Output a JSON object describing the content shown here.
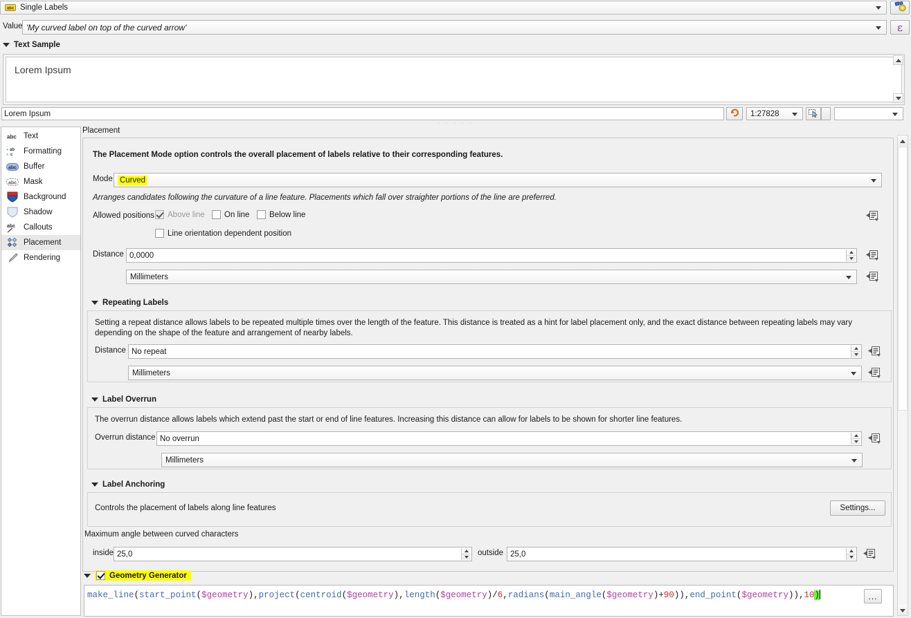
{
  "topbar": {
    "labeling_mode": "Single Labels",
    "labeling_mode_icon": "abc-label-icon",
    "style_button_icon": "style-manager-icon"
  },
  "value_row": {
    "label": "Value",
    "value": "'My curved label on top of the curved arrow'",
    "expression_button_icon": "epsilon-icon"
  },
  "text_sample": {
    "header": "Text Sample",
    "preview_text": "Lorem Ipsum",
    "input_value": "Lorem Ipsum",
    "undo_icon": "undo-arrow-icon",
    "scale": "1:27828",
    "select_icon": "select-cursor-icon",
    "misc_value": ""
  },
  "sidebar": {
    "items": [
      {
        "label": "Text",
        "icon": "text-abc-icon"
      },
      {
        "label": "Formatting",
        "icon": "formatting-icon"
      },
      {
        "label": "Buffer",
        "icon": "buffer-abc-icon"
      },
      {
        "label": "Mask",
        "icon": "mask-abc-icon"
      },
      {
        "label": "Background",
        "icon": "background-shield-icon"
      },
      {
        "label": "Shadow",
        "icon": "shadow-shield-icon"
      },
      {
        "label": "Callouts",
        "icon": "callouts-icon"
      },
      {
        "label": "Placement",
        "icon": "placement-diamonds-icon"
      },
      {
        "label": "Rendering",
        "icon": "rendering-brush-icon"
      }
    ],
    "selected": "Placement"
  },
  "panel": {
    "title": "Placement",
    "intro": "The Placement Mode option controls the overall placement of labels relative to their corresponding features.",
    "mode": {
      "label": "Mode",
      "value": "Curved",
      "highlighted": true
    },
    "mode_description": "Arranges candidates following the curvature of a line feature. Placements which fall over straighter portions of the line are preferred.",
    "allowed_positions": {
      "label": "Allowed positions",
      "options": [
        {
          "label": "Above line",
          "checked": true,
          "disabled": true
        },
        {
          "label": "On line",
          "checked": false,
          "disabled": false
        },
        {
          "label": "Below line",
          "checked": false,
          "disabled": false
        }
      ],
      "line_orientation": {
        "label": "Line orientation dependent position",
        "checked": false
      }
    },
    "distance": {
      "label": "Distance",
      "value": "0,0000",
      "unit": "Millimeters"
    },
    "repeating_labels": {
      "header": "Repeating Labels",
      "description": "Setting a repeat distance allows labels to be repeated multiple times over the length of the feature. This distance is treated as a hint for label placement only, and the exact distance between repeating labels may vary depending on the shape of the feature and arrangement of nearby labels.",
      "distance_label": "Distance",
      "distance_value": "No repeat",
      "unit": "Millimeters"
    },
    "label_overrun": {
      "header": "Label Overrun",
      "description": "The overrun distance allows labels which extend past the start or end of line features. Increasing this distance can allow for labels to be shown for shorter line features.",
      "distance_label": "Overrun distance",
      "distance_value": "No overrun",
      "unit": "Millimeters"
    },
    "label_anchoring": {
      "header": "Label Anchoring",
      "description": "Controls the placement of labels along line features",
      "settings_button": "Settings..."
    },
    "max_angle": {
      "title": "Maximum angle between curved characters",
      "inside_label": "inside",
      "inside_value": "25,0",
      "outside_label": "outside",
      "outside_value": "25,0"
    },
    "override_icon": "data-defined-override-icon"
  },
  "geometry_generator": {
    "header": "Geometry Generator",
    "checked": true,
    "highlighted": true,
    "expression_tokens": [
      {
        "t": "make_line",
        "c": "fn"
      },
      {
        "t": "(",
        "c": "punc"
      },
      {
        "t": "start_point",
        "c": "fn"
      },
      {
        "t": "(",
        "c": "punc"
      },
      {
        "t": "$geometry",
        "c": "geo"
      },
      {
        "t": "),",
        "c": "punc"
      },
      {
        "t": "project",
        "c": "fn"
      },
      {
        "t": "(",
        "c": "punc"
      },
      {
        "t": "centroid",
        "c": "fn"
      },
      {
        "t": "(",
        "c": "punc"
      },
      {
        "t": "$geometry",
        "c": "geo"
      },
      {
        "t": "),",
        "c": "punc"
      },
      {
        "t": "length",
        "c": "fn"
      },
      {
        "t": "(",
        "c": "punc"
      },
      {
        "t": "$geometry",
        "c": "geo"
      },
      {
        "t": ")/",
        "c": "punc"
      },
      {
        "t": "6",
        "c": "num"
      },
      {
        "t": ",",
        "c": "punc"
      },
      {
        "t": "radians",
        "c": "fn"
      },
      {
        "t": "(",
        "c": "punc"
      },
      {
        "t": "main_angle",
        "c": "fn"
      },
      {
        "t": "(",
        "c": "punc"
      },
      {
        "t": "$geometry",
        "c": "geo"
      },
      {
        "t": ")+",
        "c": "punc"
      },
      {
        "t": "90",
        "c": "num"
      },
      {
        "t": ")),",
        "c": "punc"
      },
      {
        "t": "end_point",
        "c": "fn"
      },
      {
        "t": "(",
        "c": "punc"
      },
      {
        "t": "$geometry",
        "c": "geo"
      },
      {
        "t": ")),",
        "c": "punc"
      },
      {
        "t": "10",
        "c": "num"
      },
      {
        "t": ")",
        "c": "punc brk-hl"
      }
    ],
    "expression_text": "make_line(start_point($geometry),project(centroid($geometry),length($geometry)/6,radians(main_angle($geometry)+90)),end_point($geometry)),10)",
    "edit_button": "..."
  },
  "colors": {
    "highlight": "#ffff00",
    "bracket_match": "#66ff33",
    "function": "#3d6bb5",
    "variable": "#b33ea8",
    "number": "#d12b2b",
    "panel_bg": "#f0f0f0"
  }
}
